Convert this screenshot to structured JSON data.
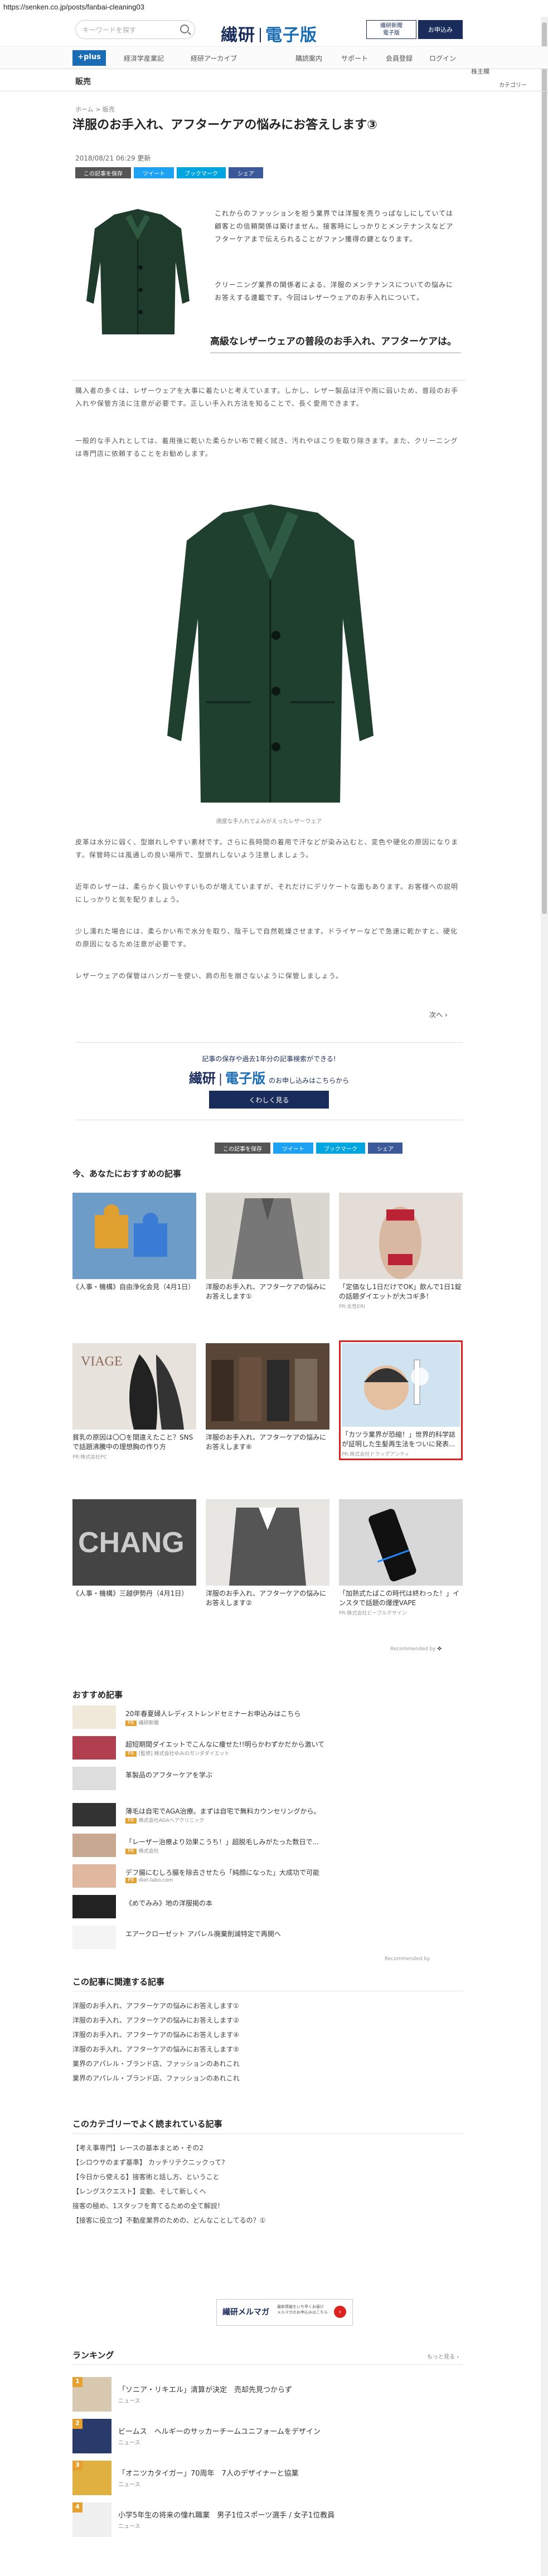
{
  "browser": {
    "url": "https://senken.co.jp/posts/fanbai-cleaning03"
  },
  "header": {
    "search_placeholder": "キーワードを探す",
    "logo_main": "繊研",
    "logo_sub": "電子版",
    "btn_paper": "繊研新聞\n電子版",
    "btn_paper_line1": "繊研新聞",
    "btn_paper_line2": "電子版",
    "btn_signup": "お申込み"
  },
  "nav": {
    "plus": "+plus",
    "items": [
      "経済学産業記",
      "経研アーカイブ",
      "購読案内",
      "サポート",
      "会員登録",
      "ログイン"
    ],
    "badge": "株主欄"
  },
  "subnav": {
    "section": "販売",
    "right": "カテゴリー"
  },
  "breadcrumb": "ホーム > 販売",
  "article": {
    "title": "洋服のお手入れ、アフターケアの悩みにお答えします③",
    "date": "2018/08/21 06:29 更新",
    "share": [
      "この記事を保存",
      "ツイート",
      "ブックマーク",
      "シェア"
    ],
    "lead": [
      "これからのファッションを担う業界では洋服を売りっぱなしにしていては顧客との信頼関係は築けません。接客時にしっかりとメンテナンスなどアフターケアまで伝えられることがファン獲得の鍵となります。",
      "クリーニング業界の関係者による、洋服のメンテナンスについての悩みにお答えする連載です。今回はレザーウェアのお手入れについて。"
    ],
    "h2": "高級なレザーウェアの普段のお手入れ、アフターケアは。",
    "body1": [
      "購入者の多くは、レザーウェアを大事に着たいと考えています。しかし、レザー製品は汗や雨に弱いため、普段のお手入れや保管方法に注意が必要です。正しい手入れ方法を知ることで、長く愛用できます。",
      "一般的な手入れとしては、着用後に乾いた柔らかい布で軽く拭き、汚れやほこりを取り除きます。また、クリーニングは専門店に依頼することをお勧めします。"
    ],
    "image_caption": "適度な手入れでよみがえったレザーウェア",
    "body2": [
      "皮革は水分に弱く、型崩れしやすい素材です。さらに長時間の着用で汗などが染み込むと、変色や硬化の原因になります。保管時には風通しの良い場所で、型崩れしないよう注意しましょう。",
      "近年のレザーは、柔らかく扱いやすいものが増えていますが、それだけにデリケートな面もあります。お客様への説明にしっかりと気を配りましょう。",
      "少し濡れた場合には、柔らかい布で水分を取り、陰干しで自然乾燥させます。ドライヤーなどで急速に乾かすと、硬化の原因になるため注意が必要です。",
      "レザーウェアの保管はハンガーを使い、肩の形を崩さないように保管しましょう。"
    ],
    "pager": "次へ"
  },
  "promo": {
    "line1": "記事の保存や過去1年分の記事検索ができる!",
    "logo_main": "繊研",
    "logo_sub": "電子版",
    "logo_suffix": "のお申し込みはこちらから",
    "button": "くわしく見る"
  },
  "share2": [
    "この記事を保存",
    "ツイート",
    "ブックマーク",
    "シェア"
  ],
  "recommended": {
    "title": "今、あなたにおすすめの記事",
    "cards": [
      {
        "caption": "《人事・機構》自由浄化会見（4月1日）",
        "pr": ""
      },
      {
        "caption": "洋服のお手入れ、アフターケアの悩みにお答えします①",
        "pr": ""
      },
      {
        "caption": "「定価なし1日だけでOK」飲んで1日1錠の話題ダイエットが大コギ多！",
        "pr": "PR:女性ERI"
      },
      {
        "caption": "貧乳の原因は〇〇を間違えたこと？SNSで話題沸騰中の理想胸の作り方",
        "pr": "PR:株式会社PC"
      },
      {
        "caption": "洋服のお手入れ、アフターケアの悩みにお答えします⑥",
        "pr": ""
      },
      {
        "caption": "「カツラ業界が恐縮！」世界的科学誌が証明した生髪再生法をついに発表...",
        "pr": "PR:株式会社ドラッグアンティ"
      },
      {
        "caption": "《人事・機構》三越伊勢丹（4月1日）",
        "pr": ""
      },
      {
        "caption": "洋服のお手入れ、アフターケアの悩みにお答えします②",
        "pr": ""
      },
      {
        "caption": "「加熱式たばこの時代は終わった！」インスタで話題の爆煙VAPE",
        "pr": "PR:株式会社ビーブルデザイン"
      }
    ],
    "footer": "Recommended by"
  },
  "osusume": {
    "title": "おすすめ記事",
    "items": [
      {
        "title": "20年春夏婦人レディストレンドセミナーお申込みはこちら",
        "meta": "繊研新聞"
      },
      {
        "title": "超短期間ダイエットでこんなに痩せた!!明らかわずかだから激いて",
        "meta": "[監修] 株式会社ゆみのガンダダイエット"
      },
      {
        "title": "革製品のアフターケアを学ぶ",
        "meta": ""
      },
      {
        "title": "薄毛は自宅でAGA治療。まずは自宅で無料カウンセリングから。",
        "meta": "株式会社AGAヘアクリニック"
      },
      {
        "title": "「レーザー治療より効果こうち！」超脱毛しみがたった数日で...",
        "meta": "株式会社"
      },
      {
        "title": "デフ腸にむしろ腸を除去させたら「純顔になった」大成功で可能",
        "meta": "diet-labo.com"
      },
      {
        "title": "《めでみみ》地の洋服掲の本",
        "meta": ""
      },
      {
        "title": "エアークローゼット アパレル廃棄削減特定で再開へ",
        "meta": ""
      }
    ],
    "footer": "Recommended by"
  },
  "related": {
    "title": "この記事に関連する記事",
    "items": [
      "洋服のお手入れ、アフターケアの悩みにお答えします①",
      "洋服のお手入れ、アフターケアの悩みにお答えします②",
      "洋服のお手入れ、アフターケアの悩みにお答えします④",
      "洋服のお手入れ、アフターケアの悩みにお答えします⑤",
      "業界のアパレル・ブランド店、ファッションのあれこれ",
      "業界のアパレル・ブランド店、ファッションのあれこれ"
    ]
  },
  "category_popular": {
    "title": "このカテゴリーでよく読まれている記事",
    "items": [
      "【考え事専門】レースの基本まとめ・その2",
      "【シロウサのまず基準】 カッチリテクニックって?",
      "【今日から使える】接客術と話し方、ということ",
      "【レングスクエスト】変動、そして新しくへ",
      "接客の極め、1スタッフを育てるための全て解説！",
      "【接客に役立つ】不動産業界のための、どんなことしてるの？①"
    ]
  },
  "mailmag": {
    "title": "繊研メルマガ",
    "desc": "最新情報をいち早くお届け\nメルマガのお申込みはこちら"
  },
  "ranking": {
    "title": "ランキング",
    "more": "もっと見る",
    "items": [
      {
        "rank": "1",
        "title": "「ソニア・リキエル」清算が決定　売却先見つからず",
        "meta": "ニュース"
      },
      {
        "rank": "2",
        "title": "ビームス　ヘルギーのサッカーチームユニフォームをデザイン",
        "meta": "ニュース"
      },
      {
        "rank": "3",
        "title": "「オニツカタイガー」70周年　7人のデザイナーと協業",
        "meta": "ニュース"
      },
      {
        "rank": "4",
        "title": "小学5年生の将来の憧れ職業　男子1位スポーツ選手 / 女子1位教員",
        "meta": "ニュース"
      }
    ]
  },
  "colors": {
    "navy": "#1a2c5b",
    "blue": "#1a6db5",
    "twitter": "#1da1f2",
    "hatena": "#00a4de",
    "facebook": "#3b5998",
    "orange": "#e6a030",
    "red": "#d22"
  }
}
